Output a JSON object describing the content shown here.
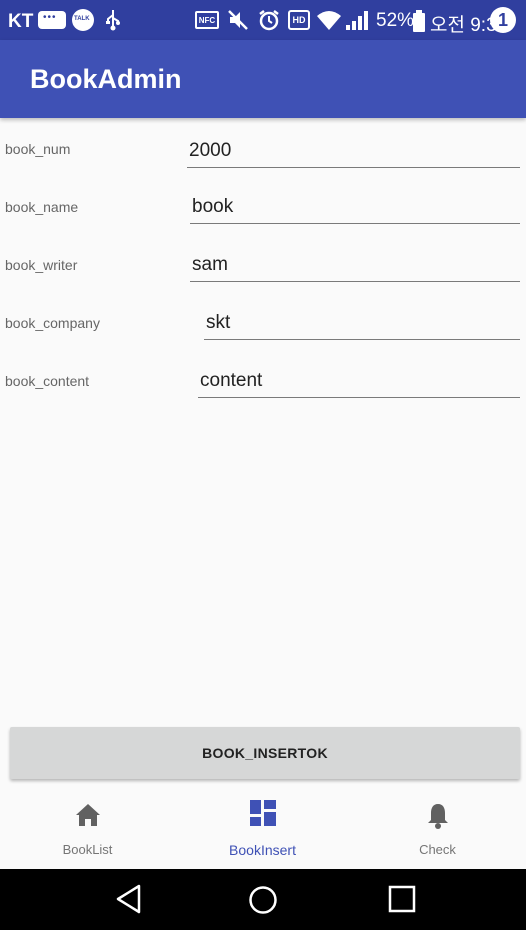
{
  "status_bar": {
    "carrier": "KT",
    "battery": "52%",
    "time": "오전 9:31",
    "notification_count": "1",
    "nfc_label": "NFC",
    "hd_label": "HD"
  },
  "app_bar": {
    "title": "BookAdmin"
  },
  "form": {
    "fields": [
      {
        "label": "book_num",
        "value": "2000"
      },
      {
        "label": "book_name",
        "value": "book"
      },
      {
        "label": "book_writer",
        "value": "sam"
      },
      {
        "label": "book_company",
        "value": "skt"
      },
      {
        "label": "book_content",
        "value": "content"
      }
    ]
  },
  "insert_button": {
    "label": "BOOK_INSERTOK"
  },
  "bottom_nav": {
    "items": [
      {
        "label": "BookList",
        "icon": "home-icon"
      },
      {
        "label": "BookInsert",
        "icon": "dashboard-icon",
        "active": true
      },
      {
        "label": "Check",
        "icon": "bell-icon"
      }
    ]
  },
  "colors": {
    "status_bar": "#303f9f",
    "app_bar": "#3f51b5",
    "accent": "#3f51b5"
  }
}
